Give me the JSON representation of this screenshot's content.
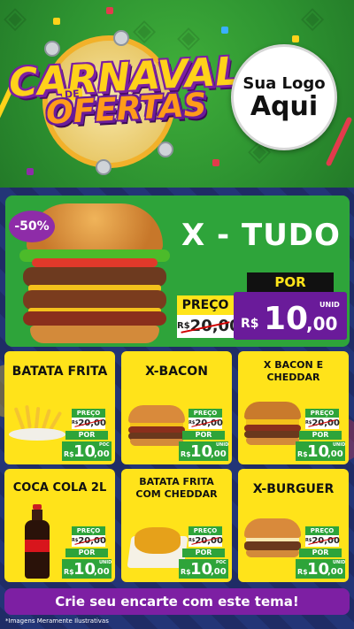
{
  "header": {
    "title_line1": "CARNAVAL",
    "title_de": "DE",
    "title_line2": "OFERTAS",
    "logo_line1": "Sua Logo",
    "logo_line2": "Aqui"
  },
  "hero": {
    "discount": "-50%",
    "name": "X - TUDO",
    "preco_label": "PREÇO",
    "old_currency": "R$",
    "old_price": "20,00",
    "por_label": "POR",
    "currency": "R$",
    "price_int": "10",
    "price_cents": ",00",
    "unit": "UNID"
  },
  "products": [
    {
      "title": "BATATA FRITA",
      "preco_label": "PREÇO",
      "old_currency": "R$",
      "old_price": "20,00",
      "por_label": "POR",
      "currency": "R$",
      "price_int": "10",
      "price_cents": ",00",
      "unit": "POC"
    },
    {
      "title": "X-BACON",
      "preco_label": "PREÇO",
      "old_currency": "R$",
      "old_price": "20,00",
      "por_label": "POR",
      "currency": "R$",
      "price_int": "10",
      "price_cents": ",00",
      "unit": "UNID"
    },
    {
      "title": "X BACON E CHEDDAR",
      "preco_label": "PREÇO",
      "old_currency": "R$",
      "old_price": "20,00",
      "por_label": "POR",
      "currency": "R$",
      "price_int": "10",
      "price_cents": ",00",
      "unit": "UNID"
    },
    {
      "title": "COCA COLA 2L",
      "preco_label": "PREÇO",
      "old_currency": "R$",
      "old_price": "20,00",
      "por_label": "POR",
      "currency": "R$",
      "price_int": "10",
      "price_cents": ",00",
      "unit": "UNID"
    },
    {
      "title": "BATATA FRITA COM CHEDDAR",
      "preco_label": "PREÇO",
      "old_currency": "R$",
      "old_price": "20,00",
      "por_label": "POR",
      "currency": "R$",
      "price_int": "10",
      "price_cents": ",00",
      "unit": "POC"
    },
    {
      "title": "X-BURGUER",
      "preco_label": "PREÇO",
      "old_currency": "R$",
      "old_price": "20,00",
      "por_label": "POR",
      "currency": "R$",
      "price_int": "10",
      "price_cents": ",00",
      "unit": "UNID"
    }
  ],
  "cta": "Crie seu encarte com este tema!",
  "footnote": "*Imagens Meramente Ilustrativas",
  "colors": {
    "green": "#2ea43a",
    "yellow": "#ffe31a",
    "purple": "#7d1fa3",
    "navy": "#1f2c66"
  }
}
